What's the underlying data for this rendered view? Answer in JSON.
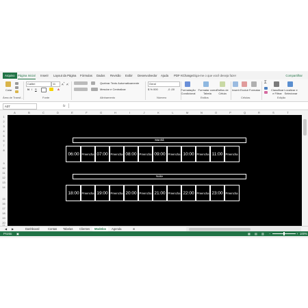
{
  "ribbon_tabs": [
    {
      "label": "Arquivo"
    },
    {
      "label": "Página Inicial"
    },
    {
      "label": "Inserir"
    },
    {
      "label": "Layout da Página"
    },
    {
      "label": "Fórmulas"
    },
    {
      "label": "Dados"
    },
    {
      "label": "Revisão"
    },
    {
      "label": "Exibir"
    },
    {
      "label": "Desenvolvedor"
    },
    {
      "label": "Ajuda"
    },
    {
      "label": "PDF-XChange"
    }
  ],
  "tell_me": "Diga-me o que você deseja fazer",
  "share": "Compartilhar",
  "ribbon": {
    "paste": "Colar",
    "font_name": "Calibri",
    "font_size": "11",
    "wrap_text": "Quebrar Texto Automaticamente",
    "merge_center": "Mesclar e Centralizar",
    "number_format": "Geral",
    "cond_format": "Formatação Condicional",
    "format_table": "Formatar como Tabela",
    "cell_styles": "Estilos de Célula",
    "insert": "Inserir",
    "delete": "Excluir",
    "format": "Formatar",
    "sort_filter": "Classificar e Filtrar",
    "find_select": "Localizar e Selecionar",
    "groups": {
      "clipboard": "Área de Transf...",
      "font": "Fonte",
      "alignment": "Alinhamento",
      "number": "Número",
      "styles": "Estilos",
      "cells": "Células",
      "editing": "Edição"
    }
  },
  "name_box": "A37",
  "fx": "fx",
  "columns": [
    "A",
    "B",
    "C",
    "D",
    "E",
    "F",
    "G",
    "H",
    "I",
    "J",
    "K",
    "L",
    "M",
    "N",
    "O",
    "P",
    "Q",
    "R",
    "S",
    "T"
  ],
  "rows": [
    "1",
    "2",
    "3",
    "4",
    "5",
    "6",
    "7",
    "8",
    "9",
    "10",
    "11",
    "12",
    "13",
    "14",
    "15",
    "16",
    "17",
    "18",
    "19",
    "20",
    "21"
  ],
  "schedule": {
    "morning": {
      "title": "Manhã",
      "slots": [
        {
          "time": "06:00",
          "fill": "Preencha"
        },
        {
          "time": "07:00",
          "fill": "Preencha"
        },
        {
          "time": "08:00",
          "fill": "Preencha"
        },
        {
          "time": "09:00",
          "fill": "Preencha"
        },
        {
          "time": "10:00",
          "fill": "Preencha"
        },
        {
          "time": "11:00",
          "fill": "Preencha"
        }
      ]
    },
    "night": {
      "title": "Noite",
      "slots": [
        {
          "time": "18:00",
          "fill": "Preencha"
        },
        {
          "time": "19:00",
          "fill": "Preencha"
        },
        {
          "time": "20:00",
          "fill": "Preencha"
        },
        {
          "time": "21:00",
          "fill": "Preencha"
        },
        {
          "time": "22:00",
          "fill": "Preencha"
        },
        {
          "time": "23:00",
          "fill": "Preencha"
        }
      ]
    }
  },
  "sheet_tabs": [
    {
      "label": "Dashboard"
    },
    {
      "label": "Contas"
    },
    {
      "label": "Tabelas"
    },
    {
      "label": "Clientes"
    },
    {
      "label": "Modelos"
    },
    {
      "label": "Agenda"
    }
  ],
  "active_sheet": "Modelos",
  "status": {
    "ready": "Pronto",
    "zoom": "100%"
  },
  "colors": {
    "accent": "#217346",
    "grid_bg": "#000000",
    "cell_border": "#ffffff"
  }
}
